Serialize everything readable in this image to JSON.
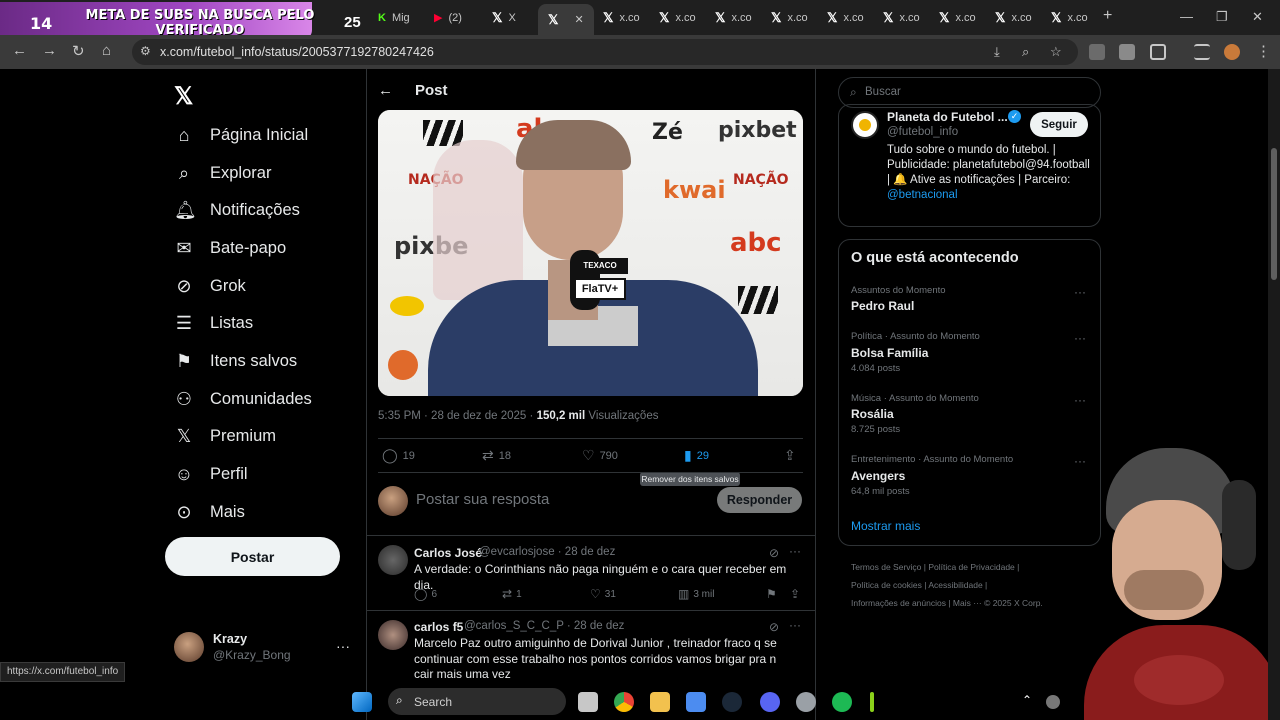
{
  "browser": {
    "stream_banner": {
      "count_left": "14",
      "text": "META DE SUBS NA BUSCA PELO VERIFICADO",
      "count_right": "25"
    },
    "tabs": [
      {
        "label": "Mig",
        "icon": "kick-icon"
      },
      {
        "label": "(2)",
        "icon": "youtube-icon"
      },
      {
        "label": "X",
        "icon": "x-icon"
      },
      {
        "label": "",
        "icon": "x-icon",
        "active": true
      },
      {
        "label": "x.co",
        "icon": "x-icon"
      },
      {
        "label": "x.co",
        "icon": "x-icon"
      },
      {
        "label": "x.co",
        "icon": "x-icon"
      },
      {
        "label": "x.co",
        "icon": "x-icon"
      },
      {
        "label": "x.co",
        "icon": "x-icon"
      },
      {
        "label": "x.co",
        "icon": "x-icon"
      },
      {
        "label": "x.co",
        "icon": "x-icon"
      },
      {
        "label": "x.co",
        "icon": "x-icon"
      }
    ],
    "url": "x.com/futebol_info/status/2005377192780247426",
    "status_url": "https://x.com/futebol_info"
  },
  "nav": {
    "items": [
      {
        "label": "Página Inicial",
        "icon": "home-icon"
      },
      {
        "label": "Explorar",
        "icon": "search-icon"
      },
      {
        "label": "Notificações",
        "icon": "bell-icon"
      },
      {
        "label": "Bate-papo",
        "icon": "mail-icon"
      },
      {
        "label": "Grok",
        "icon": "grok-icon"
      },
      {
        "label": "Listas",
        "icon": "list-icon"
      },
      {
        "label": "Itens salvos",
        "icon": "bookmark-icon"
      },
      {
        "label": "Comunidades",
        "icon": "people-icon"
      },
      {
        "label": "Premium",
        "icon": "x-icon"
      },
      {
        "label": "Perfil",
        "icon": "person-icon"
      },
      {
        "label": "Mais",
        "icon": "more-icon"
      }
    ],
    "post_button": "Postar",
    "profile": {
      "name": "Krazy",
      "handle": "@Krazy_Bong"
    }
  },
  "post": {
    "header_title": "Post",
    "image_sponsors": [
      "pixbet",
      "Zé",
      "kwai",
      "NAÇÃO",
      "abc",
      "FlaTV+",
      "TEXACO"
    ],
    "timestamp": "5:35 PM · 28 de dez de 2025 ·",
    "views_count": "150,2 mil",
    "views_label": "Visualizações",
    "replies": "19",
    "reposts": "18",
    "likes": "790",
    "bookmarks": "29",
    "bookmark_tooltip": "Remover dos itens salvos",
    "reply_placeholder": "Postar sua resposta",
    "reply_button": "Responder"
  },
  "comments": [
    {
      "name": "Carlos José",
      "handle": "@evcarlosjose · 28 de dez",
      "text": "A verdade: o Corinthians não paga ninguém e o cara quer receber em dia.",
      "replies": "6",
      "reposts": "1",
      "likes": "31",
      "views": "3 mil"
    },
    {
      "name": "carlos f5",
      "handle": "@carlos_S_C_C_P · 28 de dez",
      "text": "Marcelo Paz outro amiguinho de Dorival Junior , treinador fraco q se continuar com esse trabalho nos pontos corridos vamos brigar pra n cair mais uma vez"
    }
  ],
  "right": {
    "search_placeholder": "Buscar",
    "ad": {
      "name": "Planeta do Futebol ...",
      "handle": "@futebol_info",
      "follow": "Seguir",
      "bio": "Tudo sobre o mundo do futebol. | Publicidade: planetafutebol@94.football | 🔔 Ative as notificações | Parceiro:",
      "bio_link": "@betnacional"
    },
    "trends_title": "O que está acontecendo",
    "trends": [
      {
        "category": "Assuntos do Momento",
        "name": "Pedro Raul",
        "count": ""
      },
      {
        "category": "Política · Assunto do Momento",
        "name": "Bolsa Família",
        "count": "4.084 posts"
      },
      {
        "category": "Música · Assunto do Momento",
        "name": "Rosália",
        "count": "8.725 posts"
      },
      {
        "category": "Entretenimento · Assunto do Momento",
        "name": "Avengers",
        "count": "64,8 mil posts"
      }
    ],
    "show_more": "Mostrar mais",
    "footer": {
      "line1": "Termos de Serviço  |  Política de Privacidade  |",
      "line2": "Política de cookies  |  Acessibilidade  |",
      "line3": "Informações de anúncios  |  Mais ···  © 2025 X Corp."
    }
  },
  "taskbar": {
    "search_label": "Search"
  }
}
